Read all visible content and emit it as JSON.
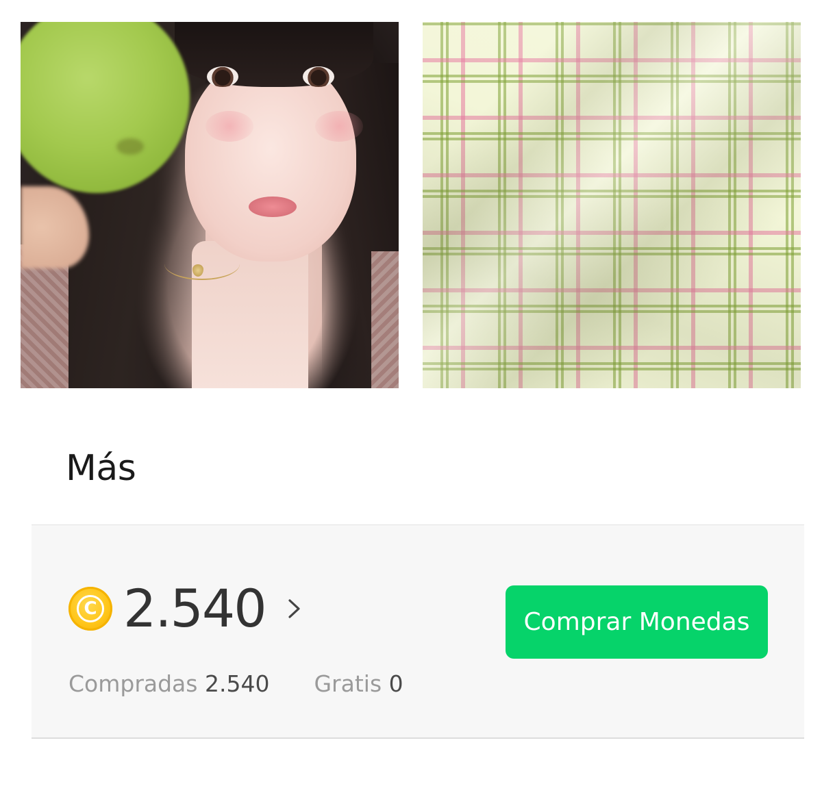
{
  "gallery": {
    "items": [
      {
        "label": "portrait-photo"
      },
      {
        "label": "plaid-fabric-photo"
      }
    ]
  },
  "more": {
    "title": "Más"
  },
  "wallet": {
    "coin_icon": "coin-icon",
    "coin_symbol": "C",
    "balance": "2.540",
    "chevron_icon": "chevron-right-icon",
    "purchased_label": "Compradas",
    "purchased_value": "2.540",
    "free_label": "Gratis",
    "free_value": "0",
    "buy_button_label": "Comprar Monedas"
  },
  "colors": {
    "accent_green": "#06d36a",
    "coin_gold": "#ffc61a",
    "panel_bg": "#f7f7f7"
  }
}
